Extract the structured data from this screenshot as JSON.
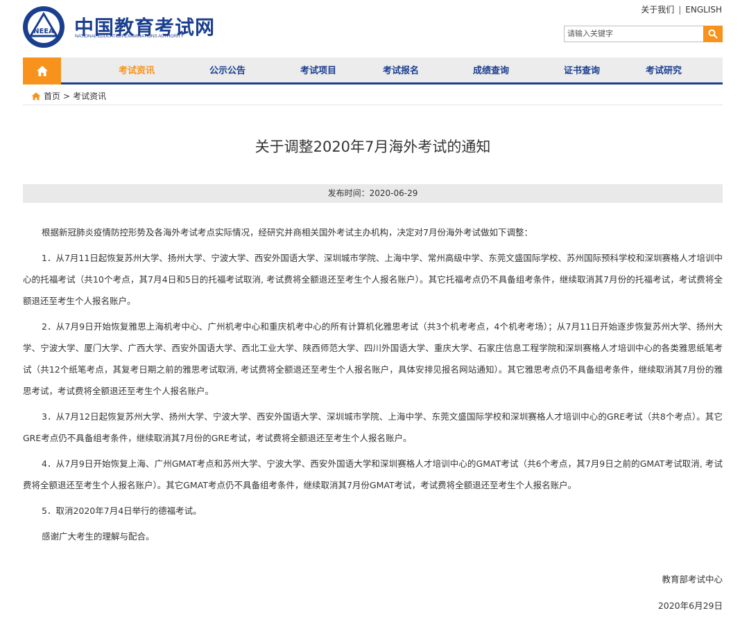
{
  "header": {
    "brand_cn": "中国教育考试网",
    "brand_en": "NATIONAL EDUCATION EXAMINATIONS AUTHORITY",
    "logo_text": "NEEA",
    "top_links": [
      "关于我们",
      "ENGLISH"
    ],
    "search_placeholder": "请输入关键字"
  },
  "nav": {
    "items": [
      "考试资讯",
      "公示公告",
      "考试项目",
      "考试报名",
      "成绩查询",
      "证书查询",
      "考试研究"
    ],
    "active": "考试资讯"
  },
  "breadcrumb": {
    "home": "首页",
    "separator": ">",
    "current": "考试资讯"
  },
  "article": {
    "title": "关于调整2020年7月海外考试的通知",
    "publish_label": "发布时间：2020-06-29",
    "paragraphs": [
      "根据新冠肺炎疫情防控形势及各海外考试考点实际情况，经研究并商相关国外考试主办机构，决定对7月份海外考试做如下调整：",
      "1．从7月11日起恢复苏州大学、扬州大学、宁波大学、西安外国语大学、深圳城市学院、上海中学、常州高级中学、东莞文盛国际学校、苏州国际预科学校和深圳赛格人才培训中心的托福考试（共10个考点，其7月4日和5日的托福考试取消, 考试费将全额退还至考生个人报名账户）。其它托福考点仍不具备组考条件，继续取消其7月份的托福考试，考试费将全额退还至考生个人报名账户。",
      "2．从7月9日开始恢复雅思上海机考中心、广州机考中心和重庆机考中心的所有计算机化雅思考试（共3个机考考点，4个机考考场）；从7月11日开始逐步恢复苏州大学、扬州大学、宁波大学、厦门大学、广西大学、西安外国语大学、西北工业大学、陕西师范大学、四川外国语大学、重庆大学、石家庄信息工程学院和深圳赛格人才培训中心的各类雅思纸笔考试（共12个纸笔考点，其复考日期之前的雅思考试取消, 考试费将全额退还至考生个人报名账户，具体安排见报名网站通知）。其它雅思考点仍不具备组考条件，继续取消其7月份的雅思考试，考试费将全额退还至考生个人报名账户。",
      "3．从7月12日起恢复苏州大学、扬州大学、宁波大学、西安外国语大学、深圳城市学院、上海中学、东莞文盛国际学校和深圳赛格人才培训中心的GRE考试（共8个考点）。其它GRE考点仍不具备组考条件，继续取消其7月份的GRE考试，考试费将全额退还至考生个人报名账户。",
      "4．从7月9日开始恢复上海、广州GMAT考点和苏州大学、宁波大学、西安外国语大学和深圳赛格人才培训中心的GMAT考试（共6个考点，其7月9日之前的GMAT考试取消, 考试费将全额退还至考生个人报名账户）。其它GMAT考点仍不具备组考条件，继续取消其7月份GMAT考试，考试费将全额退还至考生个人报名账户。",
      "5．取消2020年7月4日举行的德福考试。",
      "感谢广大考生的理解与配合。"
    ],
    "signature": "教育部考试中心",
    "date": "2020年6月29日"
  },
  "colors": {
    "brand_blue": "#1b3f8f",
    "accent_orange": "#f7931d",
    "nav_bg": "#ececec",
    "pubbar_bg": "#e9e9e9"
  }
}
